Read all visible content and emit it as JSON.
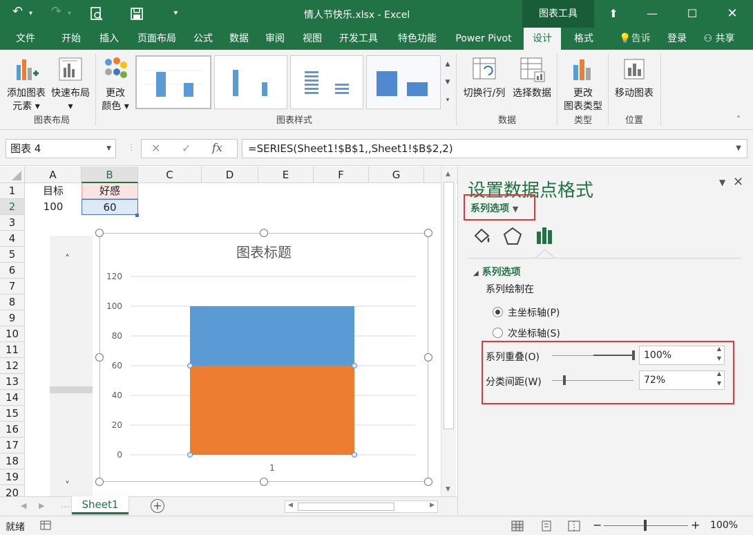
{
  "window": {
    "title": "情人节快乐.xlsx - Excel",
    "context_tab": "图表工具",
    "accent": "#217346"
  },
  "tabs": [
    "文件",
    "开始",
    "插入",
    "页面布局",
    "公式",
    "数据",
    "审阅",
    "视图",
    "开发工具",
    "特色功能",
    "Power Pivot",
    "设计",
    "格式"
  ],
  "tell_me": "告诉我...",
  "signin": "登录",
  "share": "共享",
  "ribbon": {
    "add_element": [
      "添加图表",
      "元素"
    ],
    "quick_layout": "快速布局",
    "change_colors": [
      "更改",
      "颜色"
    ],
    "group_layout": "图表布局",
    "group_styles": "图表样式",
    "switch_rowcol": "切换行/列",
    "select_data": "选择数据",
    "group_data": "数据",
    "change_type": [
      "更改",
      "图表类型"
    ],
    "group_type": "类型",
    "move_chart": "移动图表",
    "group_location": "位置"
  },
  "formula_bar": {
    "name_box": "图表 4",
    "formula": "=SERIES(Sheet1!$B$1,,Sheet1!$B$2,2)"
  },
  "grid": {
    "columns": [
      "A",
      "B",
      "C",
      "D",
      "E",
      "F",
      "G"
    ],
    "rows": [
      "1",
      "2",
      "3",
      "4",
      "5",
      "6",
      "7",
      "8",
      "9",
      "10",
      "11",
      "12",
      "13",
      "14",
      "15",
      "16",
      "17",
      "18",
      "19",
      "20"
    ],
    "a1": "目标",
    "b1": "好感",
    "a2": "100",
    "b2": "60"
  },
  "chart_data": {
    "type": "bar",
    "title": "图表标题",
    "categories": [
      "1"
    ],
    "series": [
      {
        "name": "目标",
        "values": [
          100
        ],
        "color": "#5b9bd5"
      },
      {
        "name": "好感",
        "values": [
          60
        ],
        "color": "#ed7d31"
      }
    ],
    "yticks": [
      "0",
      "20",
      "40",
      "60",
      "80",
      "100",
      "120"
    ],
    "ylim": [
      0,
      120
    ],
    "grid": true
  },
  "sheet_tab": "Sheet1",
  "status": {
    "ready": "就绪",
    "zoom": "100%"
  },
  "pane": {
    "title": "设置数据点格式",
    "dropdown": "系列选项",
    "section": "系列选项",
    "plot_on": "系列绘制在",
    "primary": "主坐标轴(P)",
    "secondary": "次坐标轴(S)",
    "overlap_label": "系列重叠(O)",
    "overlap_value": "100%",
    "gap_label": "分类间距(W)",
    "gap_value": "72%"
  }
}
